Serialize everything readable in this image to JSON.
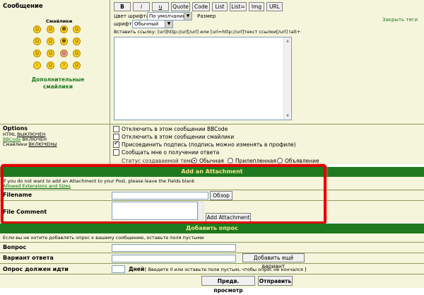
{
  "message": {
    "label": "Сообщение",
    "smilies_label": "Смайлики",
    "more_smilies": "Дополнительные смайлики"
  },
  "toolbar": {
    "buttons": [
      "B",
      "i",
      "u",
      "Quote",
      "Code",
      "List",
      "List=",
      "Img",
      "URL"
    ],
    "color_label": "Цвет шрифта:",
    "color_value": "По умолчанию",
    "size_label": "Размер",
    "size_label2": "шрифта:",
    "size_value": "Обычный",
    "close_tags": "Закрыть теги",
    "hint": "Вставить ссылку: [url]http://url[/url] или [url=http://url]текст ссылки[/url]   (alt+"
  },
  "options": {
    "title": "Options",
    "html": "HTML",
    "html_state": "ВЫКЛЮЧЕН",
    "bbcode": "BBCode",
    "bbcode_state": "ВКЛЮЧЕН",
    "smilies": "Смайлики",
    "smilies_state": "ВКЛЮЧЕНЫ",
    "items": [
      {
        "label": "Отключить в этом сообщении BBCode",
        "checked": false
      },
      {
        "label": "Отключить в этом сообщении смайлики",
        "checked": false
      },
      {
        "label": "Присоединить подпись (подпись можно изменять в профиле)",
        "checked": true
      },
      {
        "label": "Сообщать мне о получении ответа",
        "checked": false
      }
    ],
    "status_label": "Статус создаваемой темы:",
    "status_options": [
      {
        "label": "Обычная",
        "selected": true
      },
      {
        "label": "Прилепленная",
        "selected": false
      },
      {
        "label": "Объявление",
        "selected": false
      }
    ]
  },
  "attachment": {
    "header": "Add an Attachment",
    "note": "If you do not want to add an Attachment to your Post, please leave the Fields blank",
    "allowed_link": "Allowed Extensions and Sizes",
    "filename_label": "Filename",
    "browse_button": "Обзор",
    "comment_label": "File Comment",
    "add_button": "Add Attachment"
  },
  "poll": {
    "header": "Добавить опрос",
    "note": "Если вы не хотите добавлять опрос к вашему сообщению, оставьте поля пустыми",
    "question_label": "Вопрос",
    "option_label": "Вариант ответа",
    "add_option_button": "Добавить ещё вариант",
    "duration_label": "Опрос должен идти",
    "days_label": "Дней",
    "duration_hint": "[ Введите 0 или оставьте поле пустым, чтобы опрос не кончался ]"
  },
  "footer": {
    "preview_button": "Предв. просмотр",
    "submit_button": "Отправить"
  }
}
